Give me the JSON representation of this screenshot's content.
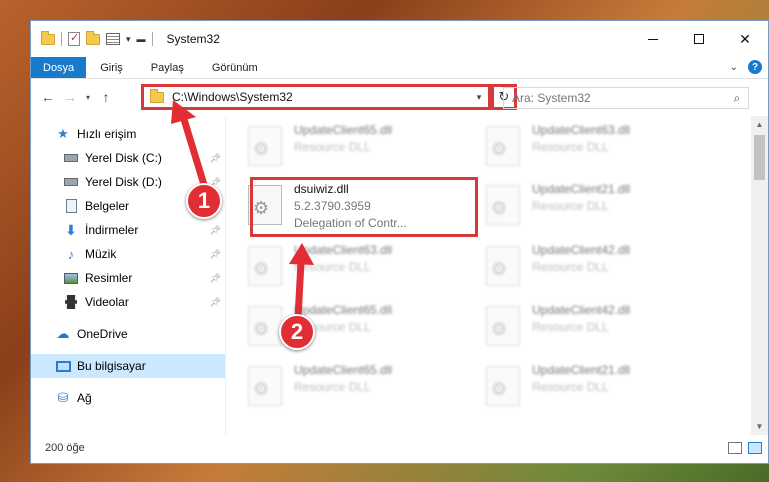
{
  "window": {
    "title": "System32",
    "ribbon_tabs": [
      "Dosya",
      "Giriş",
      "Paylaş",
      "Görünüm"
    ],
    "help_label": "?"
  },
  "address": {
    "path": "C:\\Windows\\System32",
    "search_placeholder": "Ara: System32"
  },
  "sidebar": {
    "items": [
      {
        "label": "Hızlı erişim",
        "icon": "star-icon"
      },
      {
        "label": "Yerel Disk (C:)",
        "icon": "drive-icon",
        "pinned": true
      },
      {
        "label": "Yerel Disk (D:)",
        "icon": "drive-icon",
        "pinned": true
      },
      {
        "label": "Belgeler",
        "icon": "documents-icon",
        "pinned": true
      },
      {
        "label": "İndirmeler",
        "icon": "download-icon",
        "pinned": true
      },
      {
        "label": "Müzik",
        "icon": "music-icon",
        "pinned": true
      },
      {
        "label": "Resimler",
        "icon": "pictures-icon",
        "pinned": true
      },
      {
        "label": "Videolar",
        "icon": "videos-icon",
        "pinned": true
      },
      {
        "label": "OneDrive",
        "icon": "onedrive-icon"
      },
      {
        "label": "Bu bilgisayar",
        "icon": "computer-icon",
        "selected": true
      },
      {
        "label": "Ağ",
        "icon": "network-icon"
      }
    ]
  },
  "files": {
    "focused": {
      "name": "dsuiwiz.dll",
      "version": "5.2.3790.3959",
      "description": "Delegation of Contr..."
    },
    "blurred": [
      {
        "name": "UpdateClient65.dll",
        "type": "Resource DLL"
      },
      {
        "name": "UpdateClient63.dll",
        "type": "Resource DLL"
      },
      {
        "name": "UpdateClient21.dll",
        "type": "Resource DLL"
      },
      {
        "name": "UpdateClient63.dll",
        "type": "Resource DLL"
      },
      {
        "name": "UpdateClient42.dll",
        "type": "Resource DLL"
      },
      {
        "name": "UpdateClient65.dll",
        "type": "Resource DLL"
      },
      {
        "name": "UpdateClient42.dll",
        "type": "Resource DLL"
      },
      {
        "name": "UpdateClient65.dll",
        "type": "Resource DLL"
      },
      {
        "name": "UpdateClient21.dll",
        "type": "Resource DLL"
      }
    ]
  },
  "status": {
    "count": "200 öğe"
  },
  "annotations": {
    "step1": "1",
    "step2": "2",
    "color": "#e02e34"
  }
}
